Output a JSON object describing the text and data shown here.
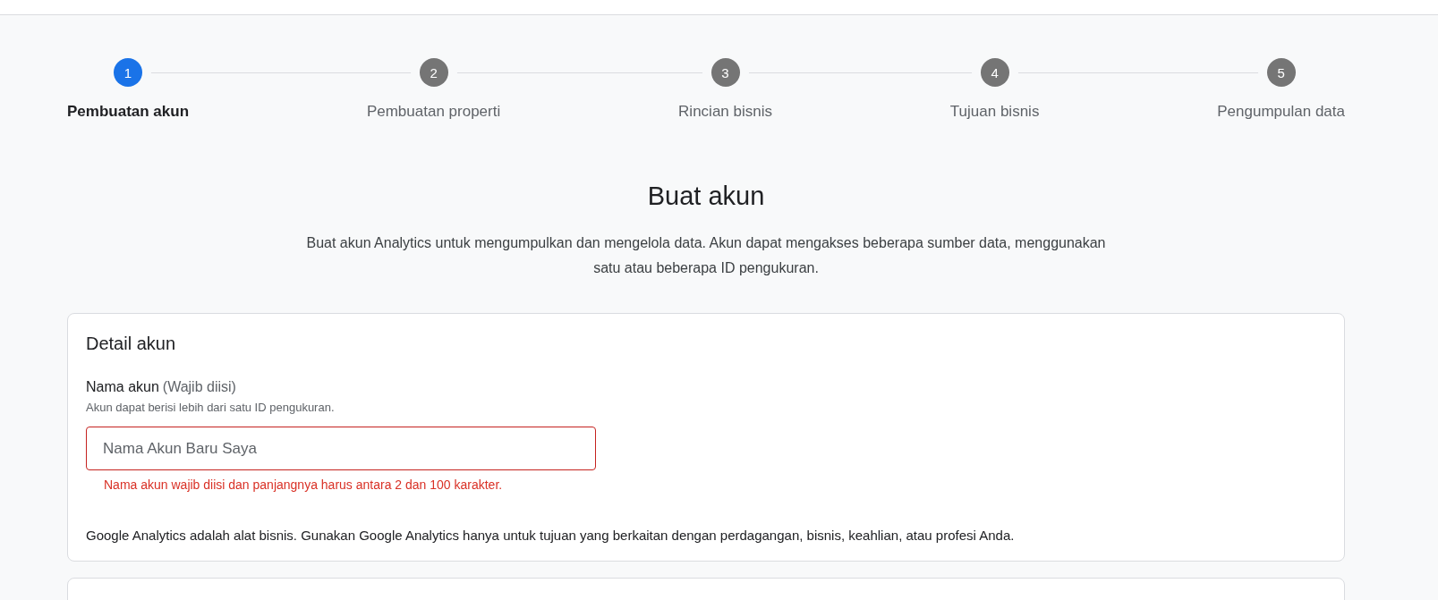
{
  "stepper": [
    {
      "number": "1",
      "label": "Pembuatan akun",
      "selected": true
    },
    {
      "number": "2",
      "label": "Pembuatan properti",
      "selected": false
    },
    {
      "number": "3",
      "label": "Rincian bisnis",
      "selected": false
    },
    {
      "number": "4",
      "label": "Tujuan bisnis",
      "selected": false
    },
    {
      "number": "5",
      "label": "Pengumpulan data",
      "selected": false
    }
  ],
  "heading": "Buat akun",
  "description": "Buat akun Analytics untuk mengumpulkan dan mengelola data. Akun dapat mengakses beberapa sumber data, menggunakan satu atau beberapa ID pengukuran.",
  "card": {
    "title": "Detail akun",
    "field": {
      "label": "Nama akun",
      "required_note": "(Wajib diisi)",
      "hint": "Akun dapat berisi lebih dari satu ID pengukuran.",
      "placeholder": "Nama Akun Baru Saya",
      "error": true,
      "error_message": "Nama akun wajib diisi dan panjangnya harus antara 2 dan 100 karakter."
    },
    "notice": "Google Analytics adalah alat bisnis. Gunakan Google Analytics hanya untuk tujuan yang berkaitan dengan perdagangan, bisnis, keahlian, atau profesi Anda."
  }
}
